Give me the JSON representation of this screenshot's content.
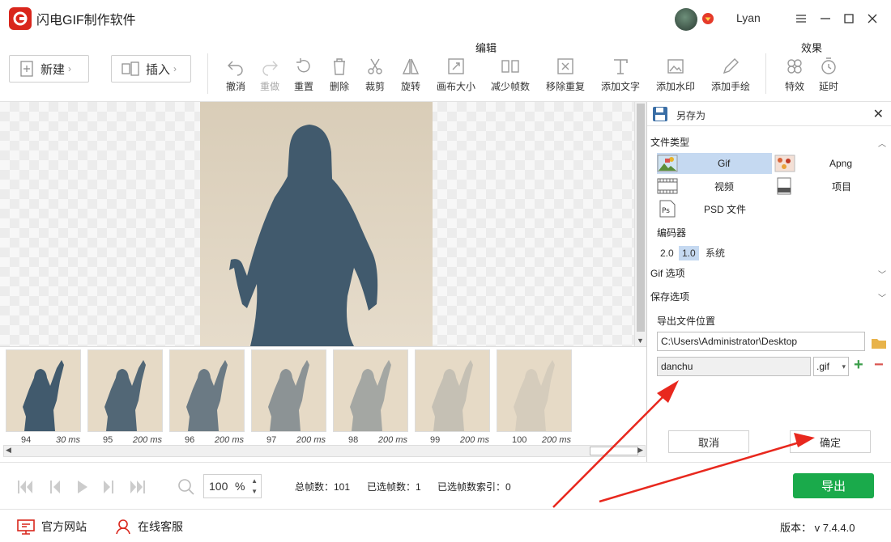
{
  "app": {
    "title": "闪电GIF制作软件",
    "username": "Lyan"
  },
  "toolbar": {
    "new_label": "新建",
    "insert_label": "插入",
    "edit_group": "编辑",
    "effects_group": "效果",
    "tools": [
      {
        "label": "撤消",
        "icon": "undo-icon"
      },
      {
        "label": "重做",
        "icon": "redo-icon"
      },
      {
        "label": "重置",
        "icon": "reset-icon"
      },
      {
        "label": "删除",
        "icon": "delete-icon"
      },
      {
        "label": "裁剪",
        "icon": "crop-icon"
      },
      {
        "label": "旋转",
        "icon": "rotate-icon"
      },
      {
        "label": "画布大小",
        "icon": "canvas-size-icon"
      },
      {
        "label": "减少帧数",
        "icon": "reduce-frames-icon"
      },
      {
        "label": "移除重复",
        "icon": "remove-duplicates-icon"
      },
      {
        "label": "添加文字",
        "icon": "add-text-icon"
      },
      {
        "label": "添加水印",
        "icon": "add-watermark-icon"
      },
      {
        "label": "添加手绘",
        "icon": "add-drawing-icon"
      },
      {
        "label": "特效",
        "icon": "effects-icon"
      },
      {
        "label": "延时",
        "icon": "delay-icon"
      }
    ]
  },
  "frames": [
    {
      "number": "94",
      "delay": "30 ms",
      "opacity": 1.0
    },
    {
      "number": "95",
      "delay": "200 ms",
      "opacity": 0.9
    },
    {
      "number": "96",
      "delay": "200 ms",
      "opacity": 0.75
    },
    {
      "number": "97",
      "delay": "200 ms",
      "opacity": 0.55
    },
    {
      "number": "98",
      "delay": "200 ms",
      "opacity": 0.4
    },
    {
      "number": "99",
      "delay": "200 ms",
      "opacity": 0.2
    },
    {
      "number": "100",
      "delay": "200 ms",
      "opacity": 0.1
    }
  ],
  "save_panel": {
    "title": "另存为",
    "file_type_title": "文件类型",
    "types": {
      "gif": "Gif",
      "apng": "Apng",
      "video": "视频",
      "project": "项目",
      "psd": "PSD 文件"
    },
    "encoder_title": "编码器",
    "encoders": [
      "2.0",
      "1.0",
      "系统"
    ],
    "selected_encoder": "1.0",
    "gif_options": "Gif 选项",
    "save_options": "保存选项",
    "export_location_title": "导出文件位置",
    "path": "C:\\Users\\Administrator\\Desktop",
    "filename": "danchu",
    "extension": ".gif",
    "cancel": "取消",
    "confirm": "确定"
  },
  "status": {
    "zoom": "100",
    "zoom_unit": "%",
    "total_frames": "总帧数：101",
    "selected_frames": "已选帧数：1",
    "selected_index": "已选帧数索引：0",
    "export": "导出"
  },
  "footer": {
    "website": "官方网站",
    "support": "在线客服",
    "version": "版本：  v 7.4.4.0"
  },
  "colors": {
    "accent_green": "#1aaa4b",
    "selection_blue": "#c5d9f1",
    "annotation_red": "#e8281e"
  }
}
